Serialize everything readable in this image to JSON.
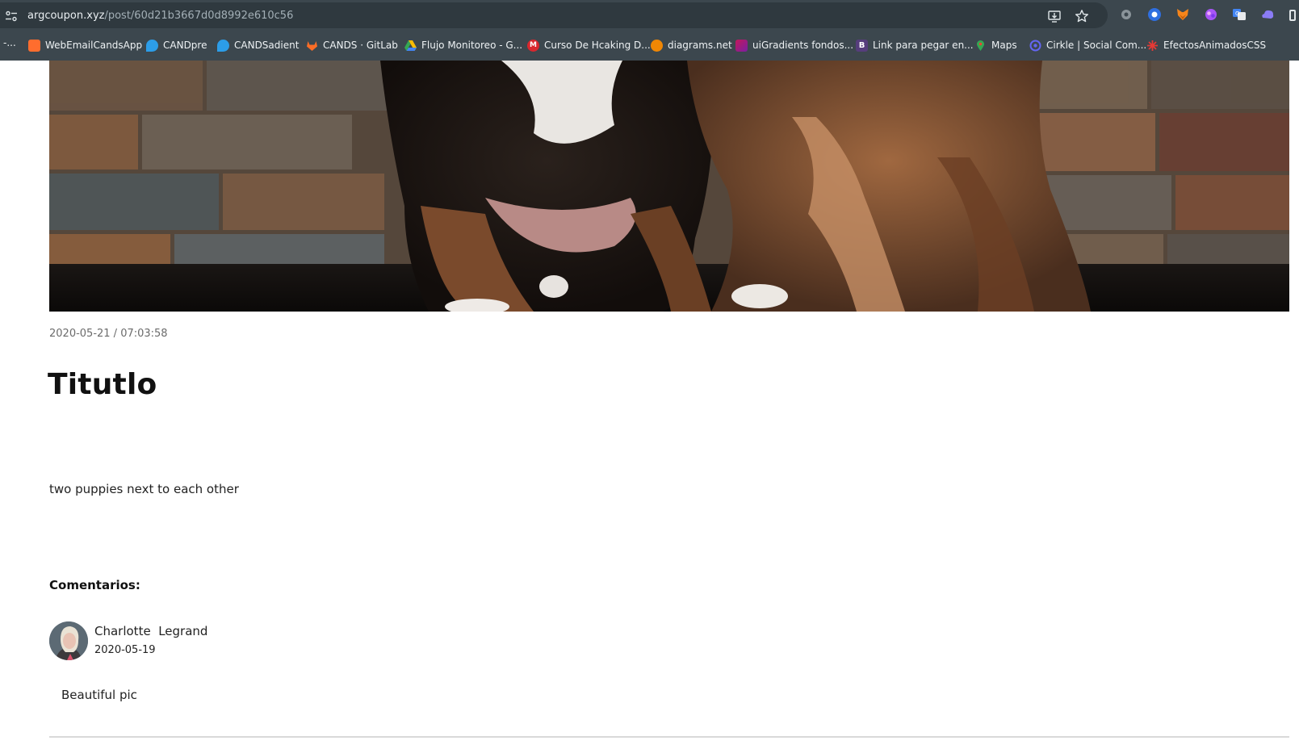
{
  "browser": {
    "url_host": "argcoupon.xyz",
    "url_path": "/post/60d21b3667d0d8992e610c56",
    "bookmark_cut_label": "-...",
    "bookmarks": [
      {
        "label": "WebEmailCandsApp",
        "icon": "webemail-icon",
        "color": "#ff6d2e"
      },
      {
        "label": "CANDpre",
        "icon": "cands-icon",
        "color": "#2c9de8"
      },
      {
        "label": "CANDSadient",
        "icon": "cands-icon",
        "color": "#2c9de8"
      },
      {
        "label": "CANDS · GitLab",
        "icon": "gitlab-icon",
        "color": "#fc6d26"
      },
      {
        "label": "Flujo Monitoreo - G...",
        "icon": "drive-icon",
        "color": "#34a853"
      },
      {
        "label": "Curso De Hcaking D...",
        "icon": "mega-icon",
        "color": "#d9272e"
      },
      {
        "label": "diagrams.net",
        "icon": "diagrams-icon",
        "color": "#f08705"
      },
      {
        "label": "uiGradients fondos...",
        "icon": "uigradients-icon",
        "color": "#c2185b"
      },
      {
        "label": "Link para pegar en...",
        "icon": "bootstrap-icon",
        "color": "#563d7c"
      },
      {
        "label": "Maps",
        "icon": "maps-icon",
        "color": "#34a853"
      },
      {
        "label": "Cirkle | Social Com...",
        "icon": "cirkle-icon",
        "color": "#4f46e5"
      },
      {
        "label": "EfectosAnimadosCSS",
        "icon": "efectos-icon",
        "color": "#e53935"
      }
    ]
  },
  "post": {
    "date": "2020-05-21 / 07:03:58",
    "title": "Titutlo",
    "description": "two puppies next to each other",
    "comments_heading": "Comentarios:",
    "comments": [
      {
        "author": "Charlotte  Legrand",
        "date": "2020-05-19",
        "text": "Beautiful pic"
      }
    ]
  }
}
